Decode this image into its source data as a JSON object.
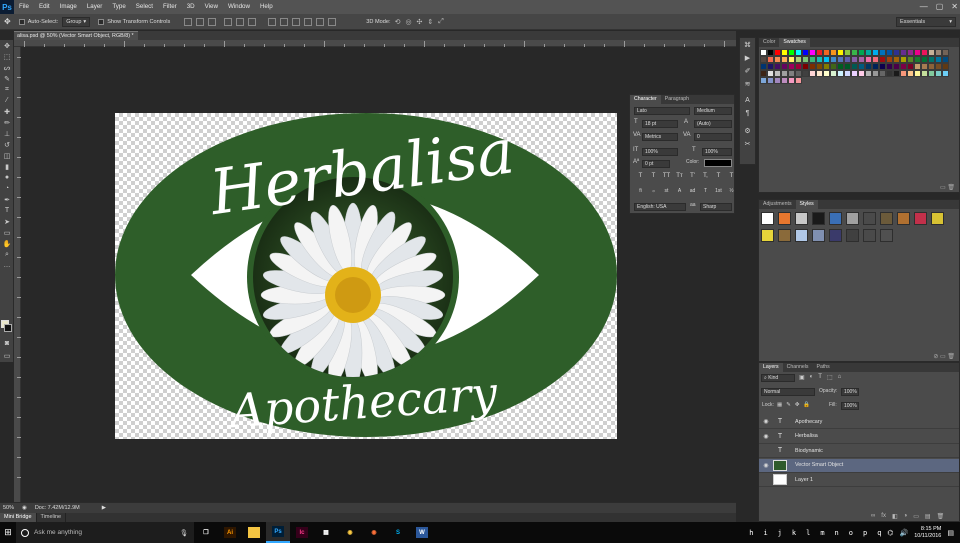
{
  "app": {
    "logo": "Ps"
  },
  "menu": [
    "File",
    "Edit",
    "Image",
    "Layer",
    "Type",
    "Select",
    "Filter",
    "3D",
    "View",
    "Window",
    "Help"
  ],
  "window_controls": [
    "—",
    "▢",
    "✕"
  ],
  "options_bar": {
    "auto_select_label": "Auto-Select:",
    "auto_select_value": "Group",
    "transform_label": "Show Transform Controls",
    "mode_3d_label": "3D Mode:",
    "workspace": "Essentials"
  },
  "document": {
    "tab_title": "alisa.psd @ 50% (Vector Smart Object, RGB/8) *",
    "zoom": "50%",
    "doc_info": "Doc: 7.42M/12.9M"
  },
  "artwork": {
    "brand_top": "Herbalisa",
    "brand_bottom": "Apothecary",
    "colors": {
      "green": "#2e5e29",
      "white": "#ffffff",
      "flower_center": "#e3b219"
    }
  },
  "bottom_tabs": [
    "Mini Bridge",
    "Timeline"
  ],
  "swatch_panel": {
    "tabs": [
      "Color",
      "Swatches"
    ],
    "colors": [
      "#ffffff",
      "#000000",
      "#ff0000",
      "#ffff00",
      "#00ff00",
      "#00ffff",
      "#0000ff",
      "#ff00ff",
      "#ed1c24",
      "#f26522",
      "#f7941d",
      "#fff200",
      "#8dc63f",
      "#39b54a",
      "#00a651",
      "#00a99d",
      "#00aeef",
      "#0072bc",
      "#0054a6",
      "#2e3192",
      "#662d91",
      "#92278f",
      "#ec008c",
      "#ed145b",
      "#c7b299",
      "#998675",
      "#736357",
      "#534741",
      "#f26c4f",
      "#f68e55",
      "#fbaf5c",
      "#fff467",
      "#acd372",
      "#7cc576",
      "#3bb878",
      "#1abbb4",
      "#00bff3",
      "#438ccb",
      "#5574b9",
      "#605ca8",
      "#855fa8",
      "#a763a8",
      "#f06ea9",
      "#f26d7d",
      "#9e0b0f",
      "#a0410d",
      "#a36209",
      "#aba000",
      "#598527",
      "#1a7b30",
      "#007236",
      "#00746b",
      "#0076a3",
      "#004b80",
      "#003471",
      "#1b1464",
      "#440e62",
      "#630460",
      "#9e005d",
      "#9e0039",
      "#790000",
      "#7b2e00",
      "#7d4900",
      "#827b00",
      "#406618",
      "#005e20",
      "#005826",
      "#005952",
      "#005b7f",
      "#003663",
      "#002157",
      "#0d004c",
      "#32004b",
      "#4b0049",
      "#7b0046",
      "#7a0026",
      "#c69c6d",
      "#a67c52",
      "#8c6239",
      "#754c24",
      "#603913",
      "#3c2415",
      "#e0e0e0",
      "#c0c0c0",
      "#a0a0a0",
      "#808080",
      "#606060",
      "#404040",
      "#ffd5d5",
      "#ffe8cc",
      "#ffffcc",
      "#d9f2d0",
      "#ccf2ff",
      "#d0d8ff",
      "#ead0ff",
      "#ffcce8",
      "#b3b3b3",
      "#999999",
      "#666666",
      "#333333",
      "#1a1a1a",
      "#f7977a",
      "#fdc68a",
      "#fff79a",
      "#c4df9b",
      "#82ca9d",
      "#7bcdc8",
      "#6dcff6",
      "#7da7d9",
      "#8393ca",
      "#a187be",
      "#bd8cbf",
      "#f49ac1",
      "#f5989d"
    ]
  },
  "styles_panel": {
    "tabs": [
      "Adjustments",
      "Styles"
    ],
    "styles": [
      "#ffffff",
      "#e8772e",
      "#c9c9c9",
      "#1a1a1a",
      "#3a6fb5",
      "#a0a0a0",
      "#4a4a4a",
      "#6b5a3a",
      "#b07030",
      "#c2304a",
      "#d8c233",
      "#e6d43a",
      "#8a6a3a",
      "#b0c8e8",
      "#8090b0",
      "#3a3a6a",
      "#404040",
      "#4a4a4a",
      "#505050"
    ]
  },
  "character_panel": {
    "tabs": [
      "Character",
      "Paragraph"
    ],
    "font_family": "Lato",
    "font_style": "Medium",
    "size": "18 pt",
    "leading": "(Auto)",
    "kerning": "Metrics",
    "tracking": "0",
    "vscale": "100%",
    "hscale": "100%",
    "baseline": "0 pt",
    "color_label": "Color:",
    "type_buttons": [
      "T",
      "T",
      "TT",
      "Tт",
      "T'",
      "T,",
      "T",
      "T"
    ],
    "opentype_buttons": [
      "fi",
      "ℴ",
      "st",
      "A",
      "ad",
      "T",
      "1st",
      "½"
    ],
    "language": "English: USA",
    "antialias": "Sharp",
    "icons": {
      "size": "T",
      "leading": "A",
      "kerning": "VA",
      "tracking": "VA",
      "vscale": "IT",
      "hscale": "T",
      "baseline": "Aª"
    }
  },
  "layers_panel": {
    "tabs": [
      "Layers",
      "Channels",
      "Paths"
    ],
    "filter": "Kind",
    "blend_mode": "Normal",
    "opacity_label": "Opacity:",
    "opacity": "100%",
    "lock_label": "Lock:",
    "fill_label": "Fill:",
    "fill": "100%",
    "filter_icons": [
      "▣",
      "◐",
      "T",
      "⬚",
      "⌂"
    ],
    "lock_icons": [
      "▦",
      "✎",
      "✥",
      "🔒"
    ],
    "footer_icons": [
      "∞",
      "fx",
      "◧",
      "◑",
      "▭",
      "▤",
      "🗑"
    ],
    "layers": [
      {
        "name": "Apothecary",
        "type": "text",
        "thumb": "T",
        "visible": true,
        "selected": false
      },
      {
        "name": "Herbalisa",
        "type": "text",
        "thumb": "T",
        "visible": true,
        "selected": false
      },
      {
        "name": "Biodynamic",
        "type": "text",
        "thumb": "T",
        "visible": false,
        "selected": false
      },
      {
        "name": "Vector Smart Object",
        "type": "smart",
        "thumb": "",
        "visible": true,
        "selected": true
      },
      {
        "name": "Layer 1",
        "type": "raster",
        "thumb": "",
        "visible": false,
        "selected": false
      }
    ]
  },
  "taskbar": {
    "search_placeholder": "Ask me anything",
    "apps": [
      {
        "name": "Illustrator",
        "label": "Ai",
        "fg": "#ff9a00",
        "bg": "#2e1600"
      },
      {
        "name": "File Explorer",
        "label": "",
        "fg": "#f4c542",
        "bg": "#f4c542"
      },
      {
        "name": "Photoshop",
        "label": "Ps",
        "fg": "#31a8ff",
        "bg": "#001e36"
      },
      {
        "name": "InCopy",
        "label": "Ic",
        "fg": "#ff3a8c",
        "bg": "#35001a"
      },
      {
        "name": "Calculator",
        "label": "▦",
        "fg": "#ffffff",
        "bg": "#0a0a0a"
      },
      {
        "name": "Chrome",
        "label": "◉",
        "fg": "#ffcd44",
        "bg": "#0a0a0a"
      },
      {
        "name": "Firefox",
        "label": "◉",
        "fg": "#ff7139",
        "bg": "#0a0a0a"
      },
      {
        "name": "Skype",
        "label": "S",
        "fg": "#00aff0",
        "bg": "#0a0a0a"
      },
      {
        "name": "Word",
        "label": "W",
        "fg": "#ffffff",
        "bg": "#2b579a"
      }
    ],
    "tray_letters": [
      "h",
      "i",
      "j",
      "k",
      "l",
      "m",
      "n",
      "o",
      "p",
      "q"
    ],
    "time": "8:15 PM",
    "date": "10/11/2016"
  }
}
